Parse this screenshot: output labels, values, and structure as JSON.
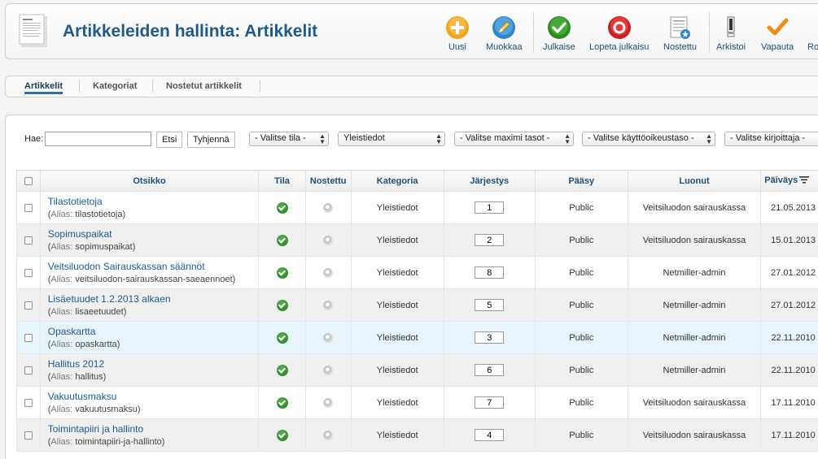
{
  "header": {
    "title": "Artikkeleiden hallinta: Artikkelit",
    "icon_name": "articles-icon",
    "toolbar": [
      {
        "label": "Uusi",
        "icon": "new-icon"
      },
      {
        "label": "Muokkaa",
        "icon": "edit-icon"
      },
      {
        "label": "Julkaise",
        "icon": "publish-icon"
      },
      {
        "label": "Lopeta julkaisu",
        "icon": "unpublish-icon"
      },
      {
        "label": "Nostettu",
        "icon": "featured-icon"
      },
      {
        "label": "Arkistoi",
        "icon": "archive-icon"
      },
      {
        "label": "Vapauta",
        "icon": "checkin-icon"
      },
      {
        "label": "Ro",
        "icon": "trash-icon"
      }
    ]
  },
  "submenu": {
    "items": [
      "Artikkelit",
      "Kategoriat",
      "Nostetut artikkelit"
    ],
    "active": "Artikkelit"
  },
  "filters": {
    "search_label": "Hae:",
    "search_value": "",
    "search_button": "Etsi",
    "clear_button": "Tyhjennä",
    "state": "- Valitse tila -",
    "category": "Yleistiedot",
    "max_level": "- Valitse maximi tasot -",
    "access": "- Valitse käyttöoikeustaso -",
    "author": "- Valitse kirjoittaja -"
  },
  "table": {
    "columns": [
      "Otsikko",
      "Tila",
      "Nostettu",
      "Kategoria",
      "Järjestys",
      "Pääsy",
      "Luonut",
      "Päiväys"
    ],
    "alias_label": "Alias:",
    "rows": [
      {
        "title": "Tilastotietoja",
        "alias": "tilastotietoja",
        "published": true,
        "featured": false,
        "category": "Yleistiedot",
        "order": "1",
        "access": "Public",
        "author": "Veitsiluodon sairauskassa",
        "date": "21.05.2013"
      },
      {
        "title": "Sopimuspaikat",
        "alias": "sopimuspaikat",
        "published": true,
        "featured": false,
        "category": "Yleistiedot",
        "order": "2",
        "access": "Public",
        "author": "Veitsiluodon sairauskassa",
        "date": "15.01.2013"
      },
      {
        "title": "Veitsiluodon Sairauskassan säännöt",
        "alias": "veitsiluodon-sairauskassan-saeaennoet",
        "published": true,
        "featured": false,
        "category": "Yleistiedot",
        "order": "8",
        "access": "Public",
        "author": "Netmiller-admin",
        "date": "27.01.2012"
      },
      {
        "title": "Lisäetuudet 1.2.2013 alkaen",
        "alias": "lisaeetuudet",
        "published": true,
        "featured": false,
        "category": "Yleistiedot",
        "order": "5",
        "access": "Public",
        "author": "Netmiller-admin",
        "date": "27.01.2012"
      },
      {
        "title": "Opaskartta",
        "alias": "opaskartta",
        "published": true,
        "featured": false,
        "category": "Yleistiedot",
        "order": "3",
        "access": "Public",
        "author": "Netmiller-admin",
        "date": "22.11.2010"
      },
      {
        "title": "Hallitus 2012",
        "alias": "hallitus",
        "published": true,
        "featured": false,
        "category": "Yleistiedot",
        "order": "6",
        "access": "Public",
        "author": "Netmiller-admin",
        "date": "22.11.2010"
      },
      {
        "title": "Vakuutusmaksu",
        "alias": "vakuutusmaksu",
        "published": true,
        "featured": false,
        "category": "Yleistiedot",
        "order": "7",
        "access": "Public",
        "author": "Veitsiluodon sairauskassa",
        "date": "17.11.2010"
      },
      {
        "title": "Toimintapiiri ja hallinto",
        "alias": "toimintapiiri-ja-hallinto",
        "published": true,
        "featured": false,
        "category": "Yleistiedot",
        "order": "4",
        "access": "Public",
        "author": "Veitsiluodon sairauskassa",
        "date": "17.11.2010"
      }
    ]
  },
  "colors": {
    "title_blue": "#1e5a8a",
    "link_blue": "#1d5b95",
    "published_green": "#2e8b2a",
    "highlight_row": "#e8f4fb"
  }
}
